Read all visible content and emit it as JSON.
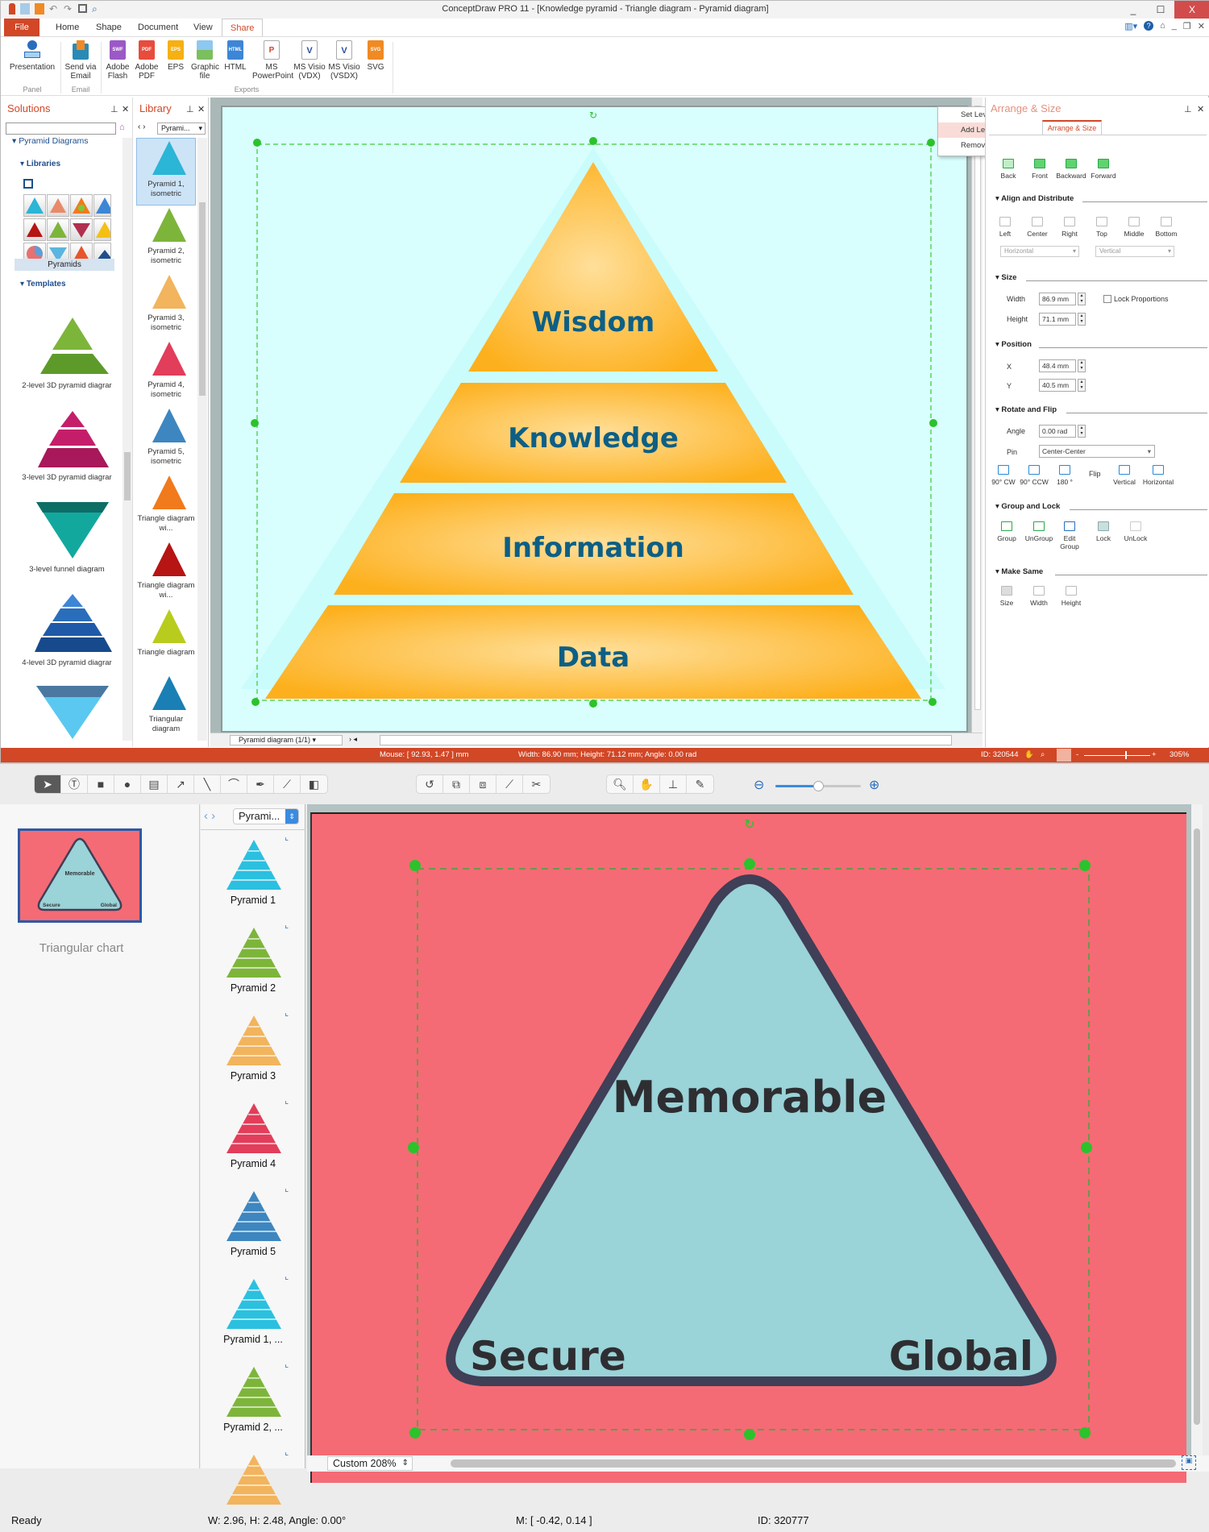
{
  "window1": {
    "title": "ConceptDraw PRO 11 - [Knowledge pyramid - Triangle diagram - Pyramid diagram]",
    "controls": [
      "_",
      "☐",
      "X"
    ],
    "tabs": [
      {
        "label": "File"
      },
      {
        "label": "Home"
      },
      {
        "label": "Shape"
      },
      {
        "label": "Document"
      },
      {
        "label": "View"
      },
      {
        "label": "Share",
        "active": true
      }
    ],
    "ribbon": {
      "buttons": [
        {
          "label": "Presentation",
          "icon": "presentation-icon"
        },
        {
          "label": "Send via Email",
          "icon": "email-icon"
        },
        {
          "label": "Adobe Flash",
          "icon": "swf-icon",
          "badge": "SWF"
        },
        {
          "label": "Adobe PDF",
          "icon": "pdf-icon",
          "badge": "PDF"
        },
        {
          "label": "EPS",
          "icon": "eps-icon",
          "badge": "EPS"
        },
        {
          "label": "Graphic file",
          "icon": "image-icon",
          "badge": ""
        },
        {
          "label": "HTML",
          "icon": "html-icon",
          "badge": "HTML"
        },
        {
          "label": "MS PowerPoint",
          "icon": "powerpoint-icon",
          "badge": "P"
        },
        {
          "label": "MS Visio (VDX)",
          "icon": "visio-vdx-icon",
          "badge": "V"
        },
        {
          "label": "MS Visio (VSDX)",
          "icon": "visio-vsdx-icon",
          "badge": "V"
        },
        {
          "label": "SVG",
          "icon": "svg-icon",
          "badge": "SVG"
        }
      ],
      "groups": [
        "Panel",
        "Email",
        "Exports"
      ]
    },
    "solutions": {
      "title": "Solutions",
      "search_value": "",
      "tree_root": "Pyramid Diagrams",
      "libraries_label": "Libraries",
      "library_name": "Pyramids",
      "templates_label": "Templates",
      "templates": [
        "2-level 3D pyramid diagrar",
        "3-level 3D pyramid diagrar",
        "3-level funnel diagram",
        "4-level 3D pyramid diagrar"
      ]
    },
    "library": {
      "title": "Library",
      "dropdown": "Pyrami...",
      "items": [
        {
          "label": "Pyramid 1, isometric",
          "color": "#2bb5d6"
        },
        {
          "label": "Pyramid 2, isometric",
          "color": "#7db53b"
        },
        {
          "label": "Pyramid 3, isometric",
          "color": "#f2b45c"
        },
        {
          "label": "Pyramid 4, isometric",
          "color": "#e23d5a"
        },
        {
          "label": "Pyramid 5, isometric",
          "color": "#3d86c0"
        },
        {
          "label": "Triangle diagram wi...",
          "color": "#f07a1c"
        },
        {
          "label": "Triangle diagram wi...",
          "color": "#b71414"
        },
        {
          "label": "Triangle diagram",
          "color": "#b8cc1e"
        },
        {
          "label": "Triangular diagram",
          "color": "#1a7fb5"
        }
      ]
    },
    "canvas": {
      "levels": [
        "Wisdom",
        "Knowledge",
        "Information",
        "Data"
      ],
      "text_color": "#0d5f85",
      "fill_color": "#fdb522",
      "page_color": "#d9fefe",
      "page_tab": "Pyramid diagram (1/1)"
    },
    "context_menu": {
      "items": [
        "Set Levels Num",
        "Add Level",
        "Remove Level"
      ],
      "highlighted": "Add Level"
    },
    "arrange_panel": {
      "title": "Arrange & Size",
      "tab": "Arrange & Size",
      "order_buttons": [
        "Back",
        "Front",
        "Backward",
        "Forward"
      ],
      "align_section": "Align and Distribute",
      "align_buttons": [
        "Left",
        "Center",
        "Right",
        "Top",
        "Middle",
        "Bottom"
      ],
      "distribute_h": "Horizontal",
      "distribute_v": "Vertical",
      "size_section": "Size",
      "width_label": "Width",
      "width_value": "86.9 mm",
      "height_label": "Height",
      "height_value": "71.1 mm",
      "lock_proportions": "Lock Proportions",
      "position_section": "Position",
      "x_label": "X",
      "x_value": "48.4 mm",
      "y_label": "Y",
      "y_value": "40.5 mm",
      "rotate_section": "Rotate and Flip",
      "angle_label": "Angle",
      "angle_value": "0.00 rad",
      "pin_label": "Pin",
      "pin_value": "Center-Center",
      "rotate_buttons": [
        "90° CW",
        "90° CCW",
        "180 °"
      ],
      "flip_label": "Flip",
      "flip_buttons": [
        "Vertical",
        "Horizontal"
      ],
      "group_section": "Group and Lock",
      "group_buttons": [
        "Group",
        "UnGroup",
        "Edit Group",
        "Lock",
        "UnLock"
      ],
      "same_section": "Make Same",
      "same_buttons": [
        "Size",
        "Width",
        "Height"
      ]
    },
    "status": {
      "mouse": "Mouse: [ 92.93, 1.47 ] mm",
      "dims": "Width: 86.90 mm;  Height: 71.12 mm;  Angle: 0.00 rad",
      "id": "ID: 320544",
      "zoom": "305%",
      "zoom_fraction": 0.62
    }
  },
  "window2": {
    "toolbar": {
      "draw_tools": [
        "select-arrow",
        "text",
        "rectangle",
        "ellipse",
        "text-block",
        "arrow",
        "line",
        "arc",
        "pen",
        "bezier-select",
        "insert-shape"
      ],
      "edit_tools": [
        "rotate",
        "group",
        "ungroup",
        "add-point",
        "scissors"
      ],
      "view_tools": [
        "zoom",
        "pan-hand",
        "stamp",
        "eyedropper"
      ],
      "zoom_slider_fraction": 0.5
    },
    "page_thumbnail": {
      "label": "Triangular chart",
      "texts": [
        "Memorable",
        "Secure",
        "Global"
      ]
    },
    "library": {
      "dropdown": "Pyrami...",
      "items": [
        {
          "label": "Pyramid 1",
          "color": "#2bc0e0"
        },
        {
          "label": "Pyramid 2",
          "color": "#7db53b"
        },
        {
          "label": "Pyramid 3",
          "color": "#f2b45c"
        },
        {
          "label": "Pyramid 4",
          "color": "#e23d5a"
        },
        {
          "label": "Pyramid 5",
          "color": "#3d86c0"
        },
        {
          "label": "Pyramid 1, ...",
          "color": "#2bc0e0"
        },
        {
          "label": "Pyramid 2, ...",
          "color": "#7db53b"
        },
        {
          "label": "",
          "color": "#f2b45c"
        }
      ]
    },
    "canvas": {
      "texts": {
        "top": "Memorable",
        "left": "Secure",
        "right": "Global"
      },
      "page_color": "#f46b75",
      "triangle_fill": "#9ad3d8",
      "triangle_stroke": "#3f3f57",
      "zoom_select": "Custom 208%"
    },
    "status": {
      "state": "Ready",
      "dims": "W: 2.96,  H: 2.48,  Angle: 0.00°",
      "mouse": "M: [ -0.42, 0.14 ]",
      "id": "ID: 320777"
    }
  }
}
